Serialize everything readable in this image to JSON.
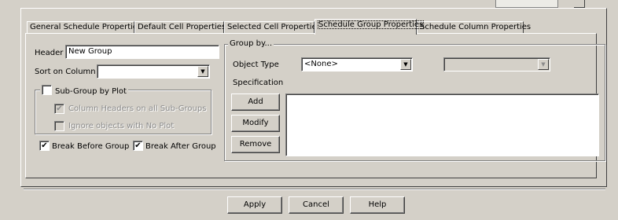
{
  "tabs": [
    {
      "label": "General Schedule Properties",
      "active": false
    },
    {
      "label": "Default Cell Properties",
      "active": false
    },
    {
      "label": "Selected Cell Properties",
      "active": false
    },
    {
      "label": "Schedule Group Properties",
      "active": true
    },
    {
      "label": "Schedule Column Properties",
      "active": false
    }
  ],
  "left": {
    "header_label": "Header",
    "header_value": "New Group",
    "sort_label": "Sort on Column",
    "sort_value": "",
    "subgroup": {
      "title": "Sub-Group by Plot",
      "checked": false,
      "col_headers_label": "Column Headers on all Sub-Groups",
      "col_headers_checked": true,
      "ignore_label": "Ignore objects with No Plot",
      "ignore_checked": false
    },
    "break_before_label": "Break Before Group",
    "break_before_checked": true,
    "break_after_label": "Break After Group",
    "break_after_checked": true
  },
  "group_by": {
    "title": "Group by...",
    "object_type_label": "Object Type",
    "object_type_value": "<None>",
    "secondary_value": "",
    "specification_label": "Specification",
    "add_label": "Add",
    "modify_label": "Modify",
    "remove_label": "Remove"
  },
  "footer": {
    "apply_label": "Apply",
    "cancel_label": "Cancel",
    "help_label": "Help"
  },
  "glyphs": {
    "check": "✔",
    "dropdown": "▼"
  }
}
